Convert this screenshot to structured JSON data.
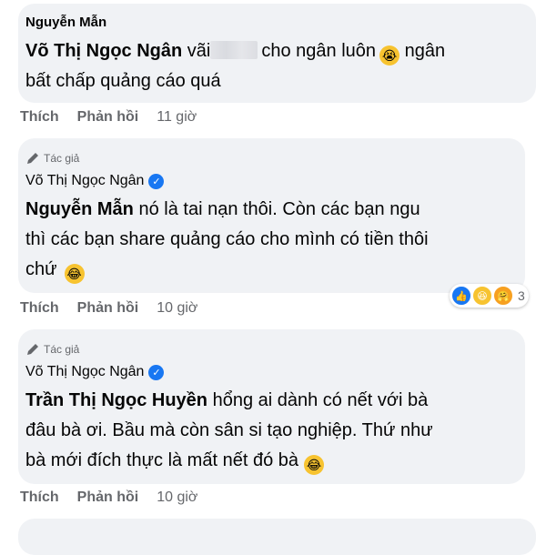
{
  "comments": [
    {
      "author": "Nguyễn Mẫn",
      "lines": [
        {
          "bold": "Võ Thị Ngọc Ngân",
          "text_a": " vãi",
          "text_b": "cho ngân luôn",
          "emoji": "😭",
          "text_c": " ngân"
        },
        {
          "text": "bất chấp quảng cáo quá"
        }
      ],
      "actions": {
        "like": "Thích",
        "reply": "Phản hồi",
        "time": "11 giờ"
      }
    },
    {
      "author_tag": "Tác giả",
      "author": "Võ Thị Ngọc Ngân",
      "lines": [
        {
          "bold": "Nguyễn Mẫn",
          "text": " nó là tai nạn thôi. Còn các bạn ngu"
        },
        {
          "text": "thì các bạn share quảng cáo cho mình có tiền thôi"
        },
        {
          "text": "chứ",
          "emoji": "😂"
        }
      ],
      "reactions_count": "3",
      "actions": {
        "like": "Thích",
        "reply": "Phản hồi",
        "time": "10 giờ"
      }
    },
    {
      "author_tag": "Tác giả",
      "author": "Võ Thị Ngọc Ngân",
      "lines": [
        {
          "bold": "Trần Thị Ngọc Huyền",
          "text": " hổng ai dành có nết với bà"
        },
        {
          "text": "đâu bà ơi. Bầu mà còn sân si tạo nghiệp. Thứ như"
        },
        {
          "text": "bà mới đích thực là mất nết đó bà",
          "emoji": "😂"
        }
      ],
      "actions": {
        "like": "Thích",
        "reply": "Phản hồi",
        "time": "10 giờ"
      }
    }
  ],
  "icons": {
    "author_tag": "pencil-icon",
    "verified": "verified-badge-icon"
  },
  "colors": {
    "bubble": "#f0f2f5",
    "meta": "#65676b",
    "verified": "#1877f2"
  }
}
